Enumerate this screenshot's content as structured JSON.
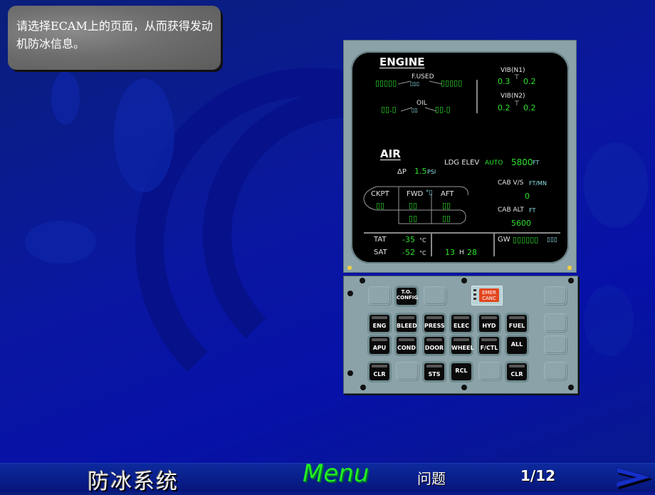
{
  "instruction": {
    "line1": "请选择ECAM上的页面，从而获得发动",
    "line2": "机防冰信息。"
  },
  "ecam": {
    "engine": {
      "title": "ENGINE",
      "fused_label": "F.USED",
      "fused_left": "▯▯▯▯▯",
      "fused_right": "▯▯▯▯▯",
      "fused_unit": "▯▯▯",
      "oil_label": "OIL",
      "oil_left": "▯▯.▯",
      "oil_right": "▯▯.▯",
      "oil_unit": "▯▯",
      "vib_n1_label": "VIB(N1)",
      "vib_n1_left": "0.3",
      "vib_n1_right": "0.2",
      "vib_n2_label": "VIB(N2)",
      "vib_n2_left": "0.2",
      "vib_n2_right": "0.2",
      "tick": "⊤"
    },
    "air": {
      "title": "AIR",
      "ldg_elev_label": "LDG ELEV",
      "ldg_elev_mode": "AUTO",
      "ldg_elev_value": "5800",
      "ldg_elev_unit": "FT",
      "dp_label": "ΔP",
      "dp_value": "1.5",
      "dp_unit": "PSI",
      "cab_vs_label": "CAB V/S",
      "cab_vs_unit": "FT/MN",
      "cab_vs_value": "0",
      "cab_alt_label": "CAB ALT",
      "cab_alt_unit": "FT",
      "cab_alt_value": "5600",
      "zones": {
        "ckpt": "CKPT",
        "fwd": "FWD",
        "aft": "AFT",
        "deg": "°▯",
        "ckpt_val": "▯▯",
        "fwd_val1": "▯▯",
        "aft_val1": "▯▯",
        "fwd_val2": "▯▯",
        "aft_val2": "▯▯"
      }
    },
    "footer": {
      "tat_label": "TAT",
      "tat_value": "-35",
      "sat_label": "SAT",
      "sat_value": "-52",
      "temp_unit": "°C",
      "time_h": "13",
      "time_sep": "H",
      "time_m": "28",
      "gw_label": "GW",
      "gw_value": "▯▯▯▯▯▯",
      "gw_unit": "▯▯▯"
    }
  },
  "panel": {
    "to_config": "T.O. CONFIG",
    "emer_canc": "EMER CANC",
    "row1": [
      "ENG",
      "BLEED",
      "PRESS",
      "ELEC",
      "HYD",
      "FUEL"
    ],
    "row2": [
      "APU",
      "COND",
      "DOOR",
      "WHEEL",
      "F/CTL",
      "ALL"
    ],
    "clr_left": "CLR",
    "sts": "STS",
    "rcl": "RCL",
    "clr_right": "CLR"
  },
  "bottom": {
    "title": "防冰系统",
    "menu": "Menu",
    "quiz": "问题",
    "page": "1/12",
    "next": ">"
  }
}
